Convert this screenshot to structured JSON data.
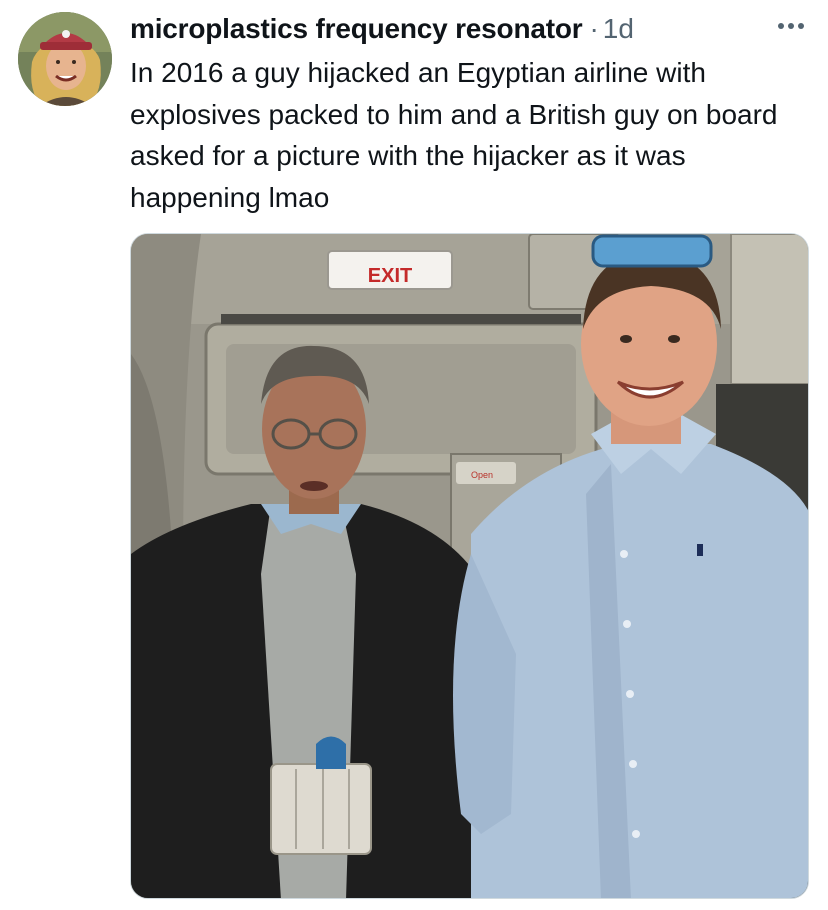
{
  "author": {
    "display_name": "microplastics frequency resonator",
    "separator": "·",
    "timestamp": "1d",
    "avatar_icon": "profile-avatar"
  },
  "tweet": {
    "text": "In 2016 a guy hijacked an Egyptian airline with explosives packed to him and a British guy on board asked for a picture with the hijacker as it was happening lmao"
  },
  "media": {
    "exit_sign": "EXIT",
    "panel_label": "Open"
  },
  "icons": {
    "more": "more-horizontal-icon"
  },
  "colors": {
    "text_primary": "#0f1419",
    "text_secondary": "#536471",
    "border": "#cfd9de"
  }
}
